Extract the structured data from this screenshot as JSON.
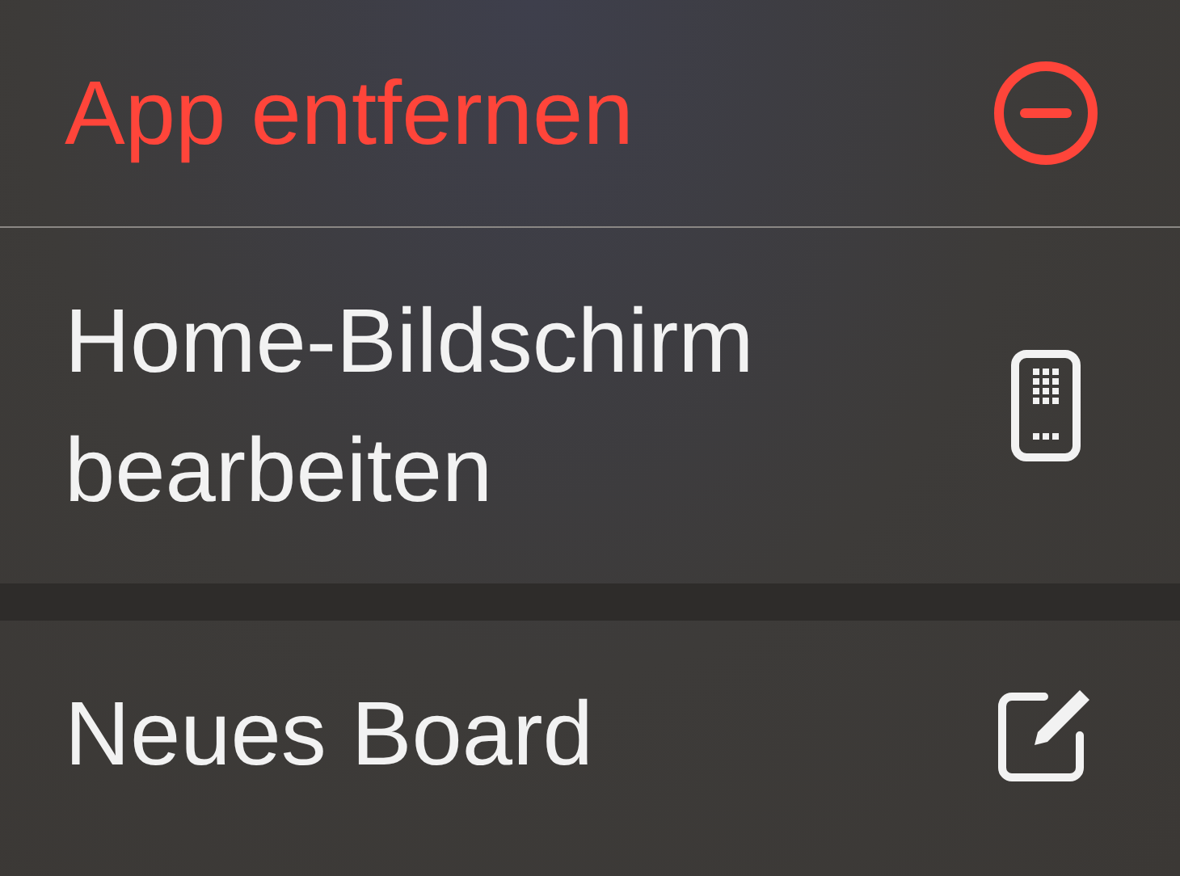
{
  "menu": {
    "groups": [
      {
        "items": [
          {
            "label": "App entfernen",
            "kind": "destructive"
          },
          {
            "label": "Home-Bildschirm bearbeiten",
            "kind": "action"
          }
        ]
      },
      {
        "items": [
          {
            "label": "Neues Board",
            "kind": "action"
          }
        ]
      }
    ]
  }
}
